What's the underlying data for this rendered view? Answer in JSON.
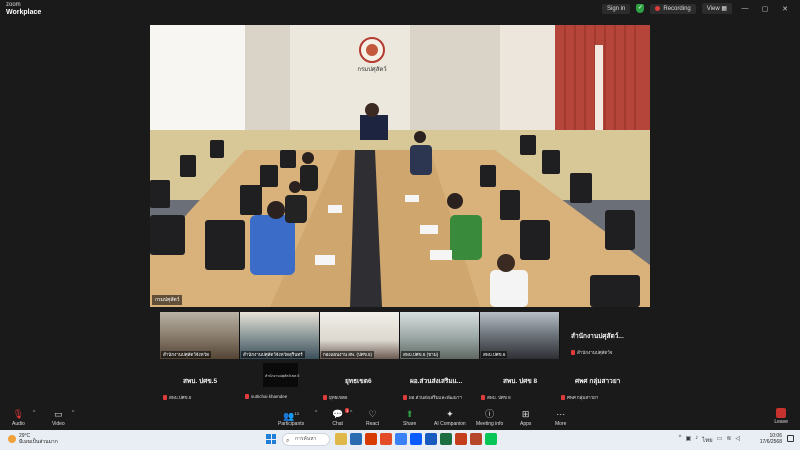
{
  "titlebar": {
    "brand_top": "zoom",
    "brand_bottom": "Workplace",
    "sign_in": "Sign in",
    "recording": "Recording",
    "view": "View"
  },
  "main_video": {
    "name": "กรมปศุสัตว์",
    "wall_sign": "กรมปศุสัตว์"
  },
  "strip": [
    {
      "label": "สำนักงานปศุสัตว์จังหวัด"
    },
    {
      "label": "สำนักงานปศุสัตว์จังหวัดสุรินทร์"
    },
    {
      "label": "กองแผนงาน สพ. (ปศข.5)"
    },
    {
      "label": "สพบ.ปศข.6 (ขาม)"
    },
    {
      "label": "สพบ.ปศข.6"
    }
  ],
  "side_tile": {
    "title": "สำนักงานปศุสัตว์...",
    "name": "สำนักงานปศุสัตว์จ"
  },
  "gallery": [
    {
      "title": "สพบ. ปศข.5",
      "name": "สพบ.ปศข.5"
    },
    {
      "title": "",
      "name": "suttichai khamdee"
    },
    {
      "title": "ยุทธเขต6",
      "name": "ยุทธเขต6"
    },
    {
      "title": "ผอ.ส่วนส่งเสริมแ...",
      "name": "ผอ.ส่วนส่งเสริมและพัฒนาฯ"
    },
    {
      "title": "สพบ. ปศข 8",
      "name": "สพบ. ปศข 8"
    },
    {
      "title": "ศพศ กลุ่มสาวยา",
      "name": "ศพศ กลุ่มสาวยา"
    }
  ],
  "small_video_label": "สำนักงานปศุสัตว์เขต 5",
  "toolbar": {
    "audio": "Audio",
    "video": "Video",
    "participants": "Participants",
    "participants_count": "13",
    "chat": "Chat",
    "chat_badge": "1",
    "react": "React",
    "share": "Share",
    "ai_companion": "AI Companion",
    "meeting_info": "Meeting info",
    "apps": "Apps",
    "more": "More",
    "leave": "Leave"
  },
  "taskbar": {
    "temp": "29°C",
    "condition": "มีเมฆเป็นส่วนมาก",
    "search_placeholder": "การค้นหา",
    "language": "ไทย",
    "time": "10:06",
    "date": "17/6/2568"
  },
  "colors": {
    "accent_red": "#e03b3b",
    "shield_green": "#2ea043",
    "background": "#1a1a1a"
  }
}
